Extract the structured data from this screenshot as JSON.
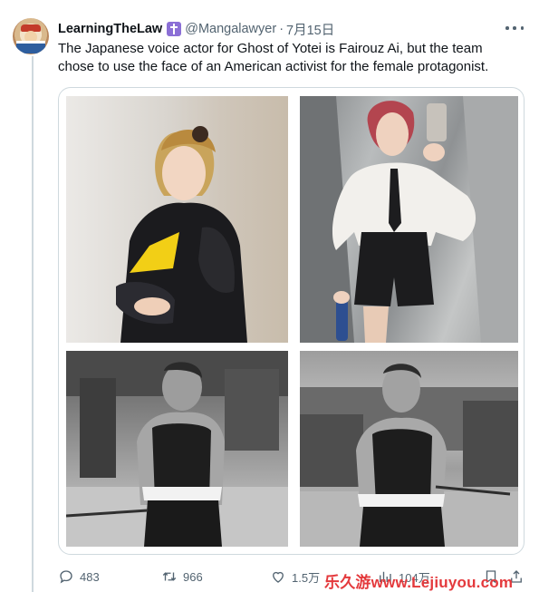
{
  "tweet": {
    "display_name": "LearningTheLaw",
    "handle": "@Mangalawyer",
    "separator": "·",
    "date": "7月15日",
    "text": "The Japanese voice actor for Ghost of Yotei is Fairouz Ai, but the team chose to use the face of an American activist for the female protagonist."
  },
  "icons": {
    "badge": "cross-badge-icon",
    "more": "more-options-icon",
    "reply": "reply-icon",
    "retweet": "retweet-icon",
    "like": "like-icon",
    "views": "views-icon",
    "bookmark": "bookmark-icon",
    "share": "share-icon"
  },
  "actions": {
    "replies": "483",
    "retweets": "966",
    "likes": "1.5万",
    "views": "104万"
  },
  "watermark": "乐久游www.Lejiuyou.com",
  "colors": {
    "text": "#0f1419",
    "secondary": "#536471",
    "border": "#cfd9de",
    "badge": "#8b6fd6",
    "watermark": "#e4393c"
  }
}
